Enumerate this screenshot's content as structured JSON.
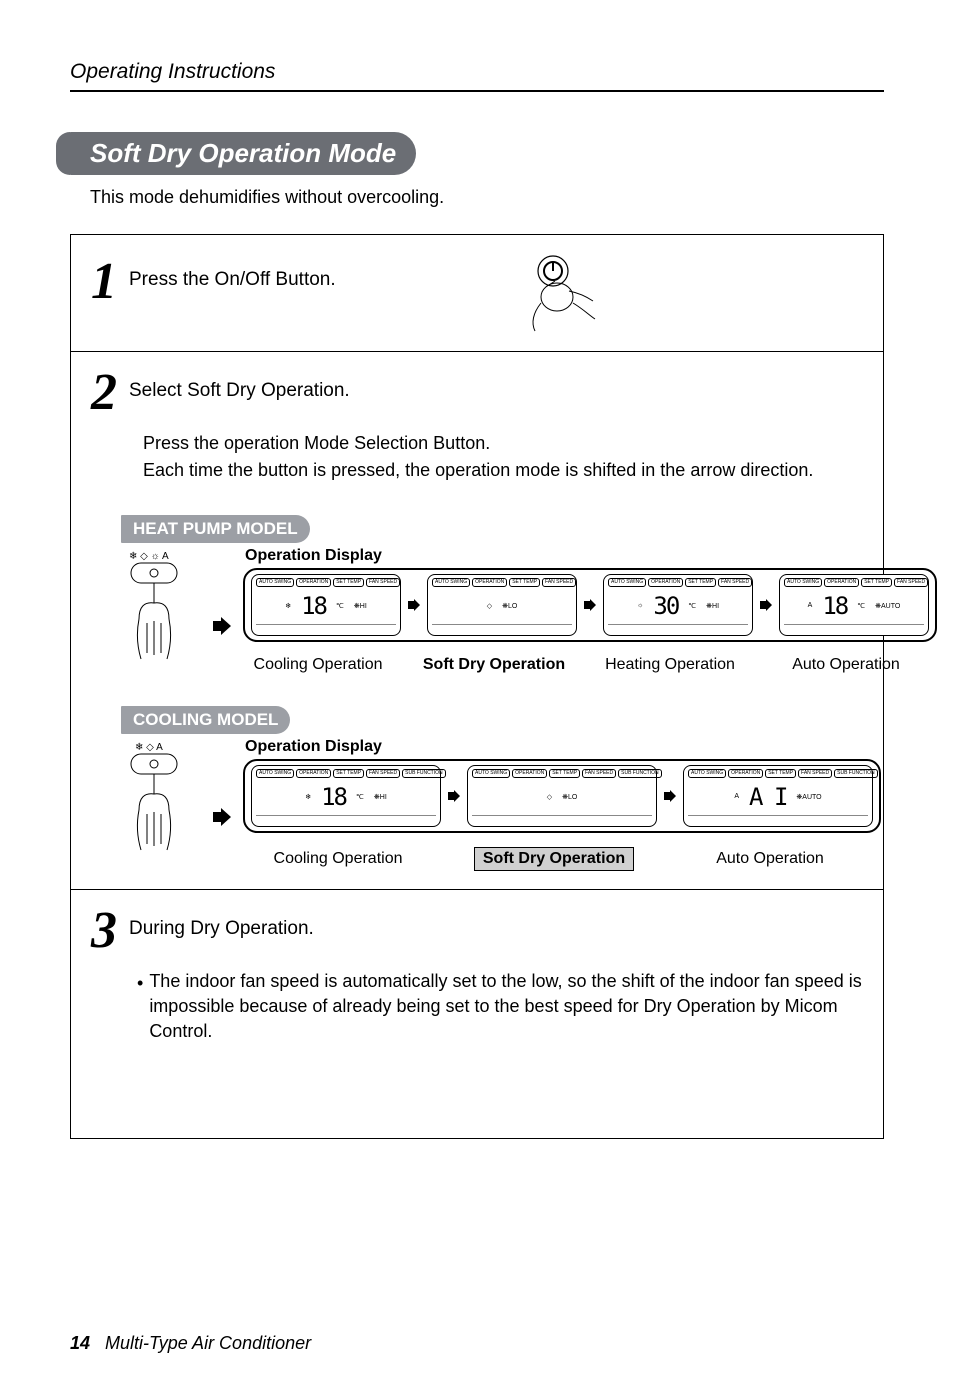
{
  "header": {
    "title": "Operating Instructions"
  },
  "section": {
    "title": "Soft Dry Operation Mode"
  },
  "intro": "This mode dehumidifies without overcooling.",
  "steps": {
    "s1": {
      "num": "1",
      "text": "Press the On/Off Button."
    },
    "s2": {
      "num": "2",
      "text": "Select Soft Dry Operation.",
      "sub1": "Press the operation Mode Selection Button.",
      "sub2": "Each time the button is pressed, the operation mode is shifted in the arrow direction."
    },
    "s3": {
      "num": "3",
      "text": "During Dry Operation.",
      "bullet": "The indoor fan speed is automatically set to the low, so the shift of the indoor fan speed is impossible because of already being set to the best speed for Dry Operation by Micom Control."
    }
  },
  "models": {
    "heat": {
      "label": "HEAT PUMP MODEL",
      "op_display": "Operation Display",
      "remote_icons": "❄ ◇ ☼ A",
      "panels": [
        {
          "pills": [
            "AUTO SWING",
            "OPERATION",
            "SET TEMP",
            "FAN SPEED"
          ],
          "icon": "❄",
          "val": "18",
          "unit": "℃",
          "fan": "HI",
          "caption": "Cooling Operation",
          "bold_caption": false,
          "hl": false
        },
        {
          "pills": [
            "AUTO SWING",
            "OPERATION",
            "SET TEMP",
            "FAN SPEED"
          ],
          "icon": "◇",
          "val": "",
          "unit": "",
          "fan": "LO",
          "caption": "Soft Dry Operation",
          "bold_caption": true,
          "hl": false
        },
        {
          "pills": [
            "AUTO SWING",
            "OPERATION",
            "SET TEMP",
            "FAN SPEED"
          ],
          "icon": "☼",
          "val": "30",
          "unit": "℃",
          "fan": "HI",
          "caption": "Heating Operation",
          "bold_caption": false,
          "hl": false
        },
        {
          "pills": [
            "AUTO SWING",
            "OPERATION",
            "SET TEMP",
            "FAN SPEED"
          ],
          "icon": "A",
          "val": "18",
          "unit": "℃",
          "fan": "AUTO",
          "caption": "Auto Operation",
          "bold_caption": false,
          "hl": false
        }
      ]
    },
    "cool": {
      "label": "COOLING MODEL",
      "op_display": "Operation Display",
      "remote_icons": "❄ ◇ A",
      "panels": [
        {
          "pills": [
            "AUTO SWING",
            "OPERATION",
            "SET TEMP",
            "FAN SPEED",
            "SUB FUNCTION"
          ],
          "icon": "❄",
          "val": "18",
          "unit": "℃",
          "fan": "HI",
          "caption": "Cooling Operation",
          "bold_caption": false,
          "hl": false
        },
        {
          "pills": [
            "AUTO SWING",
            "OPERATION",
            "SET TEMP",
            "FAN SPEED",
            "SUB FUNCTION"
          ],
          "icon": "◇",
          "val": "",
          "unit": "",
          "fan": "LO",
          "caption": "Soft Dry Operation",
          "bold_caption": true,
          "hl": true
        },
        {
          "pills": [
            "AUTO SWING",
            "OPERATION",
            "SET TEMP",
            "FAN SPEED",
            "SUB FUNCTION"
          ],
          "icon": "A",
          "val": "A I",
          "unit": "",
          "fan": "AUTO",
          "caption": "Auto Operation",
          "bold_caption": false,
          "hl": false
        }
      ]
    }
  },
  "footer": {
    "page": "14",
    "title": "Multi-Type Air Conditioner"
  }
}
